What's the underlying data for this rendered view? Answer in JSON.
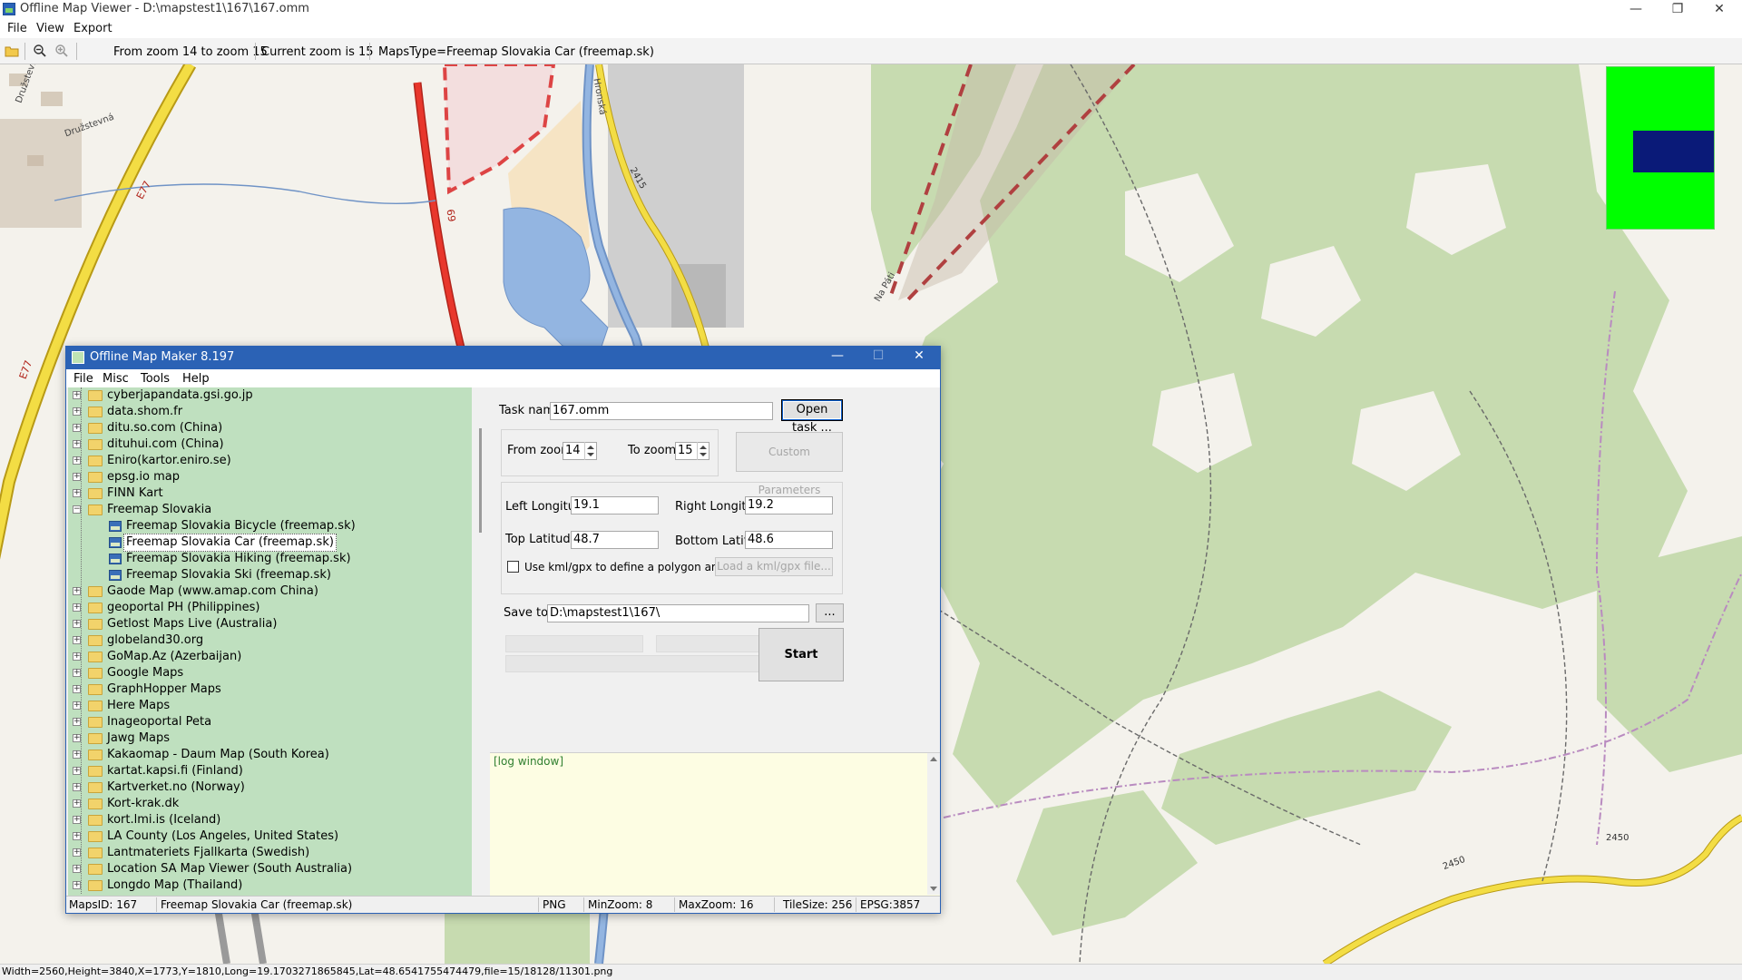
{
  "app": {
    "title": "Offline Map Viewer - D:\\mapstest1\\167\\167.omm",
    "menu": [
      "File",
      "View",
      "Export"
    ],
    "window_buttons": {
      "minimize": "—",
      "restore": "❐",
      "close": "✕"
    }
  },
  "toolbar": {
    "icons": [
      "open-folder-icon",
      "zoom-out-icon",
      "zoom-in-icon"
    ],
    "zoom_range": "From zoom 14 to zoom 15",
    "current_zoom": "Current zoom is 15",
    "maps_type": "MapsType=Freemap Slovakia Car (freemap.sk)"
  },
  "map": {
    "road_labels": [
      "E77",
      "E77",
      "69",
      "Družstevná",
      "Družstevná",
      "Hronská",
      "2415",
      "2450",
      "2450",
      "Na Páti"
    ],
    "colors": {
      "forest": "#c7dbb0",
      "background": "#f4f2ec",
      "road_major": "#e8372c",
      "road_yellow": "#f3dd44",
      "water": "#93b5e1"
    }
  },
  "minimap": {
    "colors": {
      "area": "#00ff00",
      "viewport": "#0a1a78"
    }
  },
  "viewer_status": "Width=2560,Height=3840,X=1773,Y=1810,Long=19.1703271865845,Lat=48.6541755474479,file=15/18128/11301.png",
  "dialog": {
    "title": "Offline Map Maker 8.197",
    "menu": [
      "File",
      "Misc",
      "Tools",
      "Help"
    ],
    "tree": [
      {
        "label": "cyberjapandata.gsi.go.jp",
        "type": "folder"
      },
      {
        "label": "data.shom.fr",
        "type": "folder"
      },
      {
        "label": "ditu.so.com (China)",
        "type": "folder"
      },
      {
        "label": "dituhui.com (China)",
        "type": "folder"
      },
      {
        "label": "Eniro(kartor.eniro.se)",
        "type": "folder"
      },
      {
        "label": "epsg.io map",
        "type": "folder"
      },
      {
        "label": "FINN Kart",
        "type": "folder"
      },
      {
        "label": "Freemap Slovakia",
        "type": "folder-open"
      },
      {
        "label": "Freemap Slovakia Bicycle (freemap.sk)",
        "type": "map"
      },
      {
        "label": "Freemap Slovakia Car (freemap.sk)",
        "type": "map",
        "selected": true
      },
      {
        "label": "Freemap Slovakia Hiking (freemap.sk)",
        "type": "map"
      },
      {
        "label": "Freemap Slovakia Ski (freemap.sk)",
        "type": "map"
      },
      {
        "label": "Gaode Map (www.amap.com China)",
        "type": "folder"
      },
      {
        "label": "geoportal PH (Philippines)",
        "type": "folder"
      },
      {
        "label": "Getlost Maps Live (Australia)",
        "type": "folder"
      },
      {
        "label": "globeland30.org",
        "type": "folder"
      },
      {
        "label": "GoMap.Az (Azerbaijan)",
        "type": "folder"
      },
      {
        "label": "Google Maps",
        "type": "folder"
      },
      {
        "label": "GraphHopper Maps",
        "type": "folder"
      },
      {
        "label": "Here Maps",
        "type": "folder"
      },
      {
        "label": "Inageoportal Peta",
        "type": "folder"
      },
      {
        "label": "Jawg Maps",
        "type": "folder"
      },
      {
        "label": "Kakaomap - Daum Map (South Korea)",
        "type": "folder"
      },
      {
        "label": "kartat.kapsi.fi (Finland)",
        "type": "folder"
      },
      {
        "label": "Kartverket.no (Norway)",
        "type": "folder"
      },
      {
        "label": "Kort-krak.dk",
        "type": "folder"
      },
      {
        "label": "kort.lmi.is (Iceland)",
        "type": "folder"
      },
      {
        "label": "LA County (Los Angeles, United States)",
        "type": "folder"
      },
      {
        "label": "Lantmateriets Fjallkarta (Swedish)",
        "type": "folder"
      },
      {
        "label": "Location SA Map Viewer (South Australia)",
        "type": "folder"
      },
      {
        "label": "Longdo Map (Thailand)",
        "type": "folder"
      }
    ],
    "form": {
      "task_name_label": "Task name",
      "task_name_value": "167.omm",
      "open_task_button": "Open task ...",
      "from_zoom_label": "From zoom",
      "from_zoom_value": "14",
      "to_zoom_label": "To zoom",
      "to_zoom_value": "15",
      "custom_parameters_button": "Custom Parameters",
      "left_longitude_label": "Left Longitude",
      "left_longitude_value": "19.1",
      "right_longitude_label": "Right Longitude",
      "right_longitude_value": "19.2",
      "top_latitude_label": "Top Latitude",
      "top_latitude_value": "48.7",
      "bottom_latitude_label": "Bottom Latitude",
      "bottom_latitude_value": "48.6",
      "kml_checkbox_label": "Use kml/gpx to define a polygon area",
      "load_kml_button": "Load a kml/gpx file...",
      "save_to_label": "Save to:",
      "save_to_value": "D:\\mapstest1\\167\\",
      "browse_button": "...",
      "start_button": "Start"
    },
    "log_text": "[log window]",
    "status": {
      "maps_id": "MapsID: 167",
      "maps_name": "Freemap Slovakia Car (freemap.sk)",
      "format": "PNG",
      "min_zoom": "MinZoom: 8",
      "max_zoom": "MaxZoom: 16",
      "tile_size": "TileSize: 256",
      "epsg": "EPSG:3857"
    }
  }
}
